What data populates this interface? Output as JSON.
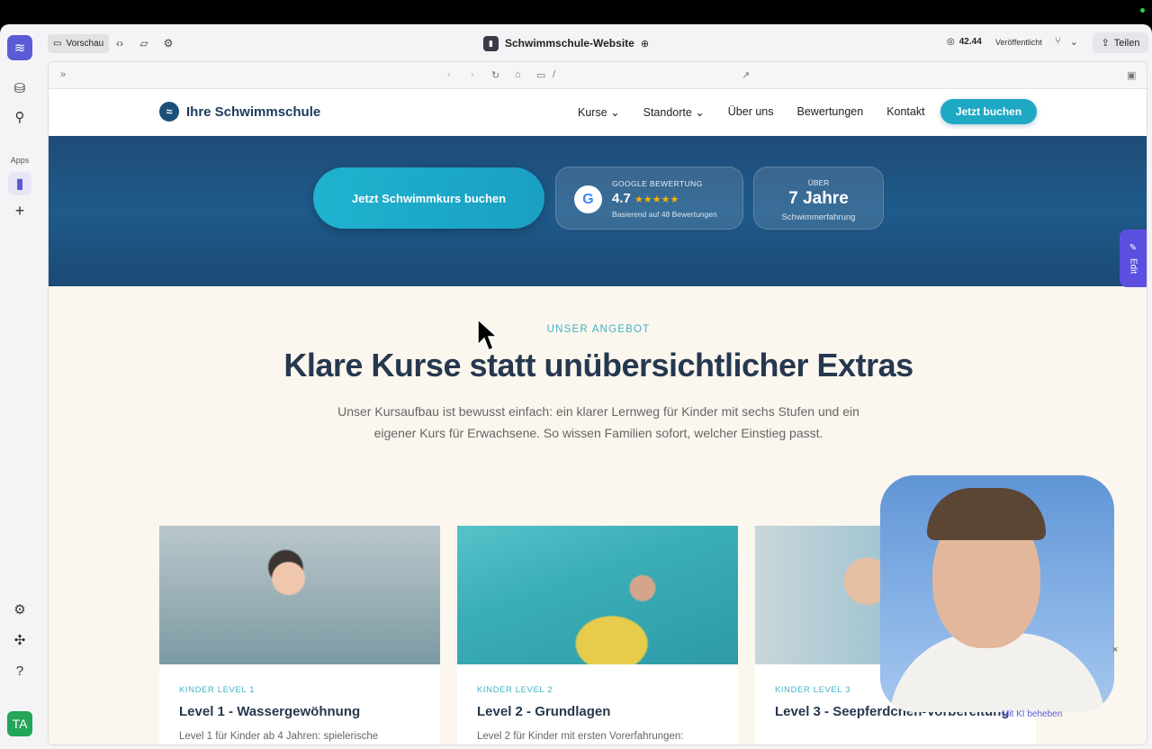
{
  "topbar": {
    "preview_label": "Vorschau",
    "project_name": "Schwimmschule-Website",
    "credits": "42.44",
    "published_label": "Veröffentlicht",
    "share_label": "Teilen"
  },
  "rail": {
    "apps_label": "Apps",
    "avatar_initials": "TA"
  },
  "urlbar": {
    "path": "/"
  },
  "site": {
    "brand": "Ihre Schwimmschule",
    "nav": [
      "Kurse",
      "Standorte",
      "Über uns",
      "Bewertungen",
      "Kontakt"
    ],
    "nav_cta": "Jetzt buchen",
    "hero_cta": "Jetzt Schwimmkurs buchen",
    "google": {
      "label": "GOOGLE BEWERTUNG",
      "rating": "4.7",
      "stars": "★★★★★",
      "sub": "Basierend auf 48 Bewertungen"
    },
    "years": {
      "over": "ÜBER",
      "value": "7 Jahre",
      "sub": "Schwimmerfahrung"
    },
    "edit_label": "Edit",
    "overline": "UNSER ANGEBOT",
    "headline": "Klare Kurse statt unübersichtlicher Extras",
    "lead": "Unser Kursaufbau ist bewusst einfach: ein klarer Lernweg für Kinder mit sechs Stufen und ein eigener Kurs für Erwachsene. So wissen Familien sofort, welcher Einstieg passt.",
    "courses": [
      {
        "level": "KINDER LEVEL 1",
        "title": "Level 1 - Wassergewöhnung",
        "desc": "Level 1 für Kinder ab 4 Jahren: spielerische"
      },
      {
        "level": "KINDER LEVEL 2",
        "title": "Level 2 - Grundlagen",
        "desc": "Level 2 für Kinder mit ersten Vorerfahrungen:"
      },
      {
        "level": "KINDER LEVEL 3",
        "title": "Level 3 - Seepferdchen-Vorbereitung",
        "desc": ""
      }
    ]
  },
  "overlay": {
    "fix_label": "Mit KI beheben",
    "close": "×"
  },
  "colors": {
    "accent": "#5b5bd6",
    "teal": "#1fa8c4",
    "navy": "#26384f"
  }
}
